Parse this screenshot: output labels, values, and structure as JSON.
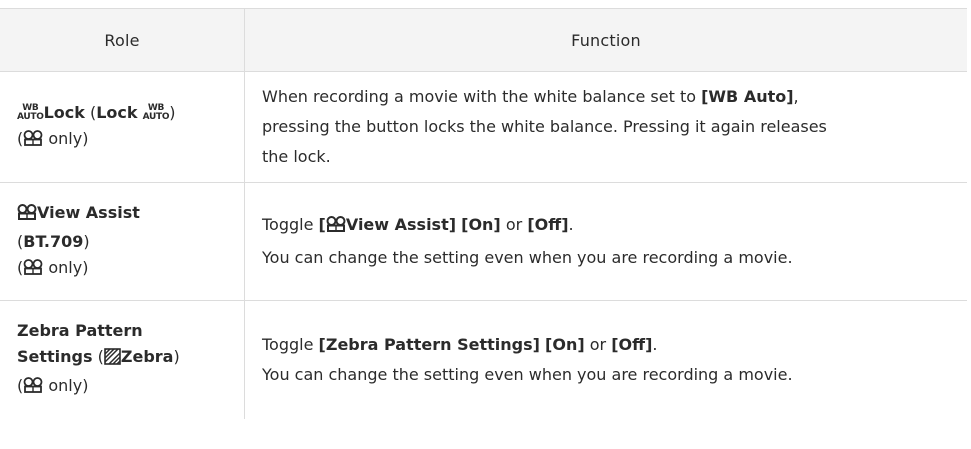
{
  "header": {
    "role": "Role",
    "function": "Function"
  },
  "rows": [
    {
      "role": {
        "name": "Lock",
        "paren_name": "Lock",
        "only": "only"
      },
      "function": {
        "t1": "When recording a movie with the white balance set to ",
        "b1": "[WB Auto]",
        "t2": ",",
        "line2": "pressing the button locks the white balance. Pressing it again releases",
        "line3": "the lock."
      }
    },
    {
      "role": {
        "name": "View Assist",
        "paren_name": "BT.709",
        "only": "only"
      },
      "function": {
        "t1": "Toggle ",
        "b1": "[",
        "b2": "View Assist]",
        "b3": "[On]",
        "t2": "or",
        "b4": "[Off]",
        "t3": ".",
        "line2": "You can change the setting even when you are recording a movie."
      }
    },
    {
      "role": {
        "name_line1": "Zebra Pattern",
        "name_line2": "Settings",
        "paren_name": "Zebra",
        "only": "only"
      },
      "function": {
        "t1": "Toggle ",
        "b1": "[Zebra Pattern Settings]",
        "b2": "[On]",
        "t2": "or",
        "b3": "[Off]",
        "t3": ".",
        "line2": "You can change the setting even when you are recording a movie."
      }
    }
  ],
  "icons": {
    "wb_top": "WB",
    "wb_bottom": "AUTO",
    "movie": "movie-icon",
    "zebra": "zebra-icon"
  }
}
